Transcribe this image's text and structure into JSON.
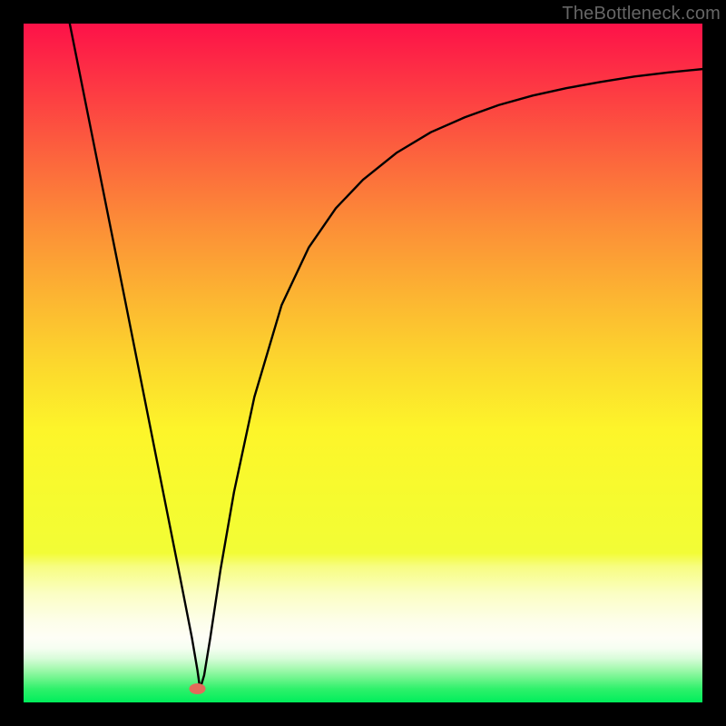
{
  "watermark": "TheBottleneck.com",
  "chart_data": {
    "type": "line",
    "title": "",
    "xlabel": "",
    "ylabel": "",
    "xlim": [
      0,
      1
    ],
    "ylim": [
      0,
      1
    ],
    "series": [
      {
        "name": "curve",
        "x": [
          0.068,
          0.1,
          0.15,
          0.2,
          0.23,
          0.248,
          0.256,
          0.26,
          0.266,
          0.275,
          0.29,
          0.31,
          0.34,
          0.38,
          0.42,
          0.46,
          0.5,
          0.55,
          0.6,
          0.65,
          0.7,
          0.75,
          0.8,
          0.85,
          0.9,
          0.95,
          1.0
        ],
        "y": [
          1.0,
          0.84,
          0.59,
          0.338,
          0.187,
          0.095,
          0.048,
          0.02,
          0.04,
          0.095,
          0.195,
          0.31,
          0.45,
          0.585,
          0.67,
          0.728,
          0.77,
          0.81,
          0.84,
          0.862,
          0.88,
          0.894,
          0.905,
          0.914,
          0.922,
          0.928,
          0.933
        ]
      }
    ],
    "marker": {
      "x": 0.256,
      "y": 0.02,
      "color": "#e26a5a"
    },
    "gradient_stops": [
      {
        "offset": 0.0,
        "color": "#fd1248"
      },
      {
        "offset": 0.03,
        "color": "#fd1e47"
      },
      {
        "offset": 0.1,
        "color": "#fd3b43"
      },
      {
        "offset": 0.2,
        "color": "#fc663d"
      },
      {
        "offset": 0.3,
        "color": "#fc8f37"
      },
      {
        "offset": 0.4,
        "color": "#fcb432"
      },
      {
        "offset": 0.5,
        "color": "#fcd72d"
      },
      {
        "offset": 0.6,
        "color": "#fdf52a"
      },
      {
        "offset": 0.7,
        "color": "#f6fb2f"
      },
      {
        "offset": 0.78,
        "color": "#f2fc36"
      },
      {
        "offset": 0.8,
        "color": "#f7fd82"
      },
      {
        "offset": 0.84,
        "color": "#fbfec4"
      },
      {
        "offset": 0.88,
        "color": "#fdfee9"
      },
      {
        "offset": 0.905,
        "color": "#fefef6"
      },
      {
        "offset": 0.92,
        "color": "#f6fef2"
      },
      {
        "offset": 0.935,
        "color": "#d9fcda"
      },
      {
        "offset": 0.95,
        "color": "#a7f9b1"
      },
      {
        "offset": 0.965,
        "color": "#6df58c"
      },
      {
        "offset": 0.98,
        "color": "#2ff16b"
      },
      {
        "offset": 1.0,
        "color": "#00ee5b"
      }
    ]
  }
}
